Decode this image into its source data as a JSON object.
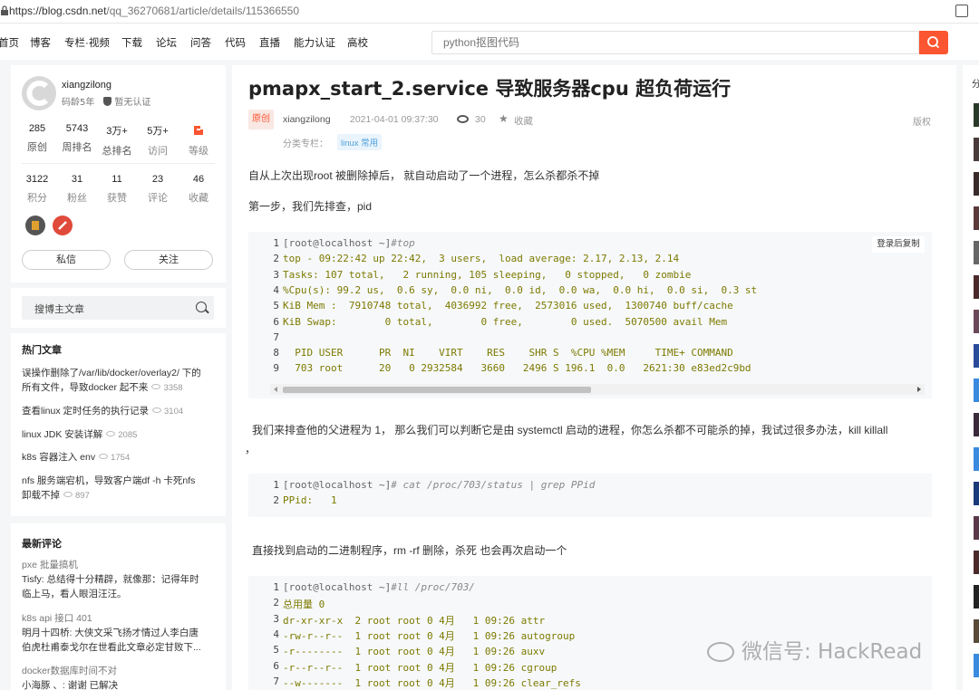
{
  "browser": {
    "url_host": "https://blog.csdn.net",
    "url_path": "/qq_36270681/article/details/115366550"
  },
  "nav": {
    "items": [
      "首页",
      "博客",
      "专栏·视频",
      "下载",
      "论坛",
      "问答",
      "代码",
      "直播",
      "能力认证",
      "高校"
    ],
    "search_placeholder": "python抠图代码"
  },
  "profile": {
    "name": "xiangzilong",
    "years": "码龄5年",
    "cert": "暂无认证",
    "stats_row1": [
      {
        "n": "285",
        "l": "原创"
      },
      {
        "n": "5743",
        "l": "周排名"
      },
      {
        "n": "3万+",
        "l": "总排名"
      },
      {
        "n": "5万+",
        "l": "访问"
      },
      {
        "n": "",
        "l": "等级"
      }
    ],
    "stats_row2": [
      {
        "n": "3122",
        "l": "积分"
      },
      {
        "n": "31",
        "l": "粉丝"
      },
      {
        "n": "11",
        "l": "获赞"
      },
      {
        "n": "23",
        "l": "评论"
      },
      {
        "n": "46",
        "l": "收藏"
      }
    ],
    "message_label": "私信",
    "follow_label": "关注"
  },
  "blog_search": {
    "label": "搜博主文章"
  },
  "hot": {
    "title": "热门文章",
    "items": [
      {
        "line1": "误操作删除了/var/lib/docker/overlay2/ 下的",
        "line2": "所有文件，导致docker 起不来",
        "count": "3358"
      },
      {
        "line1": "查看linux 定时任务的执行记录",
        "line2": "",
        "count": "3104"
      },
      {
        "line1": "linux JDK 安装详解",
        "line2": "",
        "count": "2085"
      },
      {
        "line1": "k8s 容器注入 env",
        "line2": "",
        "count": "1754"
      },
      {
        "line1": "nfs 服务端宕机，导致客户端df -h 卡死nfs",
        "line2": "卸载不掉",
        "count": "897"
      }
    ]
  },
  "comments": {
    "title": "最新评论",
    "items": [
      {
        "topic": "pxe 批量搞机",
        "text1": "Tisfy: 总结得十分精辟，就像那：记得年时",
        "text2": "临上马，看人眼泪汪汪。"
      },
      {
        "topic": "k8s api 接口 401",
        "text1": "明月十四桥: 大侠文采飞扬才情过人李白唐",
        "text2": "伯虎杜甫泰戈尔在世看此文章必定甘败下..."
      },
      {
        "topic": "docker数据库时间不对",
        "text1": "小海豚 、: 谢谢 已解决",
        "text2": ""
      }
    ]
  },
  "article": {
    "title": "pmapx_start_2.service 导致服务器cpu 超负荷运行",
    "badge": "原创",
    "author": "xiangzilong",
    "date": "2021-04-01 09:37:30",
    "views": "30",
    "fav": "收藏",
    "copyright": "版权",
    "category_label": "分类专栏：",
    "category_tag": "linux 常用",
    "p1": "自从上次出现root 被删除掉后， 就自动启动了一个进程，怎么杀都杀不掉",
    "p2": "第一步，我们先排查，pid",
    "p3": "我们来排查他的父进程为 1， 那么我们可以判断它是由 systemctl  启动的进程，你怎么杀都不可能杀的掉，我试过很多办法，kill   killall",
    "p3b": "，",
    "p4": "直接找到启动的二进制程序，rm -rf  删除，杀死 也会再次启动一个",
    "copy_label": "登录后复制",
    "code1": [
      {
        "p": "[root@localhost ~]",
        "c": "#top",
        "t": ""
      },
      {
        "p": "",
        "c": "",
        "t": "top - 09:22:42 up 22:42,  3 users,  load average: 2.17, 2.13, 2.14"
      },
      {
        "p": "",
        "c": "",
        "t": "Tasks: 107 total,   2 running, 105 sleeping,   0 stopped,   0 zombie"
      },
      {
        "p": "",
        "c": "",
        "t": "%Cpu(s): 99.2 us,  0.6 sy,  0.0 ni,  0.0 id,  0.0 wa,  0.0 hi,  0.0 si,  0.3 st"
      },
      {
        "p": "",
        "c": "",
        "t": "KiB Mem :  7910748 total,  4036992 free,  2573016 used,  1300740 buff/cache"
      },
      {
        "p": "",
        "c": "",
        "t": "KiB Swap:        0 total,        0 free,        0 used.  5070500 avail Mem"
      },
      {
        "p": "",
        "c": "",
        "t": ""
      },
      {
        "p": "",
        "c": "",
        "t": "  PID USER      PR  NI    VIRT    RES    SHR S  %CPU %MEM     TIME+ COMMAND"
      },
      {
        "p": "",
        "c": "",
        "t": "  703 root      20   0 2932584   3660   2496 S 196.1  0.0   2621:30 e83ed2c9bd"
      }
    ],
    "code2": [
      {
        "p": "[root@localhost ~]",
        "c": "# cat /proc/703/status | grep PPid",
        "t": ""
      },
      {
        "p": "",
        "c": "",
        "t": "PPid:   1"
      }
    ],
    "code3": [
      {
        "p": "[root@localhost ~]",
        "c": "#ll /proc/703/",
        "t": ""
      },
      {
        "p": "",
        "c": "",
        "t": "总用量 0"
      },
      {
        "p": "",
        "c": "",
        "t": "dr-xr-xr-x  2 root root 0 4月   1 09:26 attr"
      },
      {
        "p": "",
        "c": "",
        "t": "-rw-r--r--  1 root root 0 4月   1 09:26 autogroup"
      },
      {
        "p": "",
        "c": "",
        "t": "-r--------  1 root root 0 4月   1 09:26 auxv"
      },
      {
        "p": "",
        "c": "",
        "t": "-r--r--r--  1 root root 0 4月   1 09:26 cgroup"
      },
      {
        "p": "",
        "c": "",
        "t": "--w-------  1 root root 0 4月   1 09:26 clear_refs"
      }
    ]
  },
  "right": {
    "title": "分"
  },
  "watermark": {
    "text": "微信号: HackRead"
  },
  "colors": {
    "brand": "#fc5531",
    "link": "#4ea1db",
    "code_bg": "#f6f8fa"
  }
}
